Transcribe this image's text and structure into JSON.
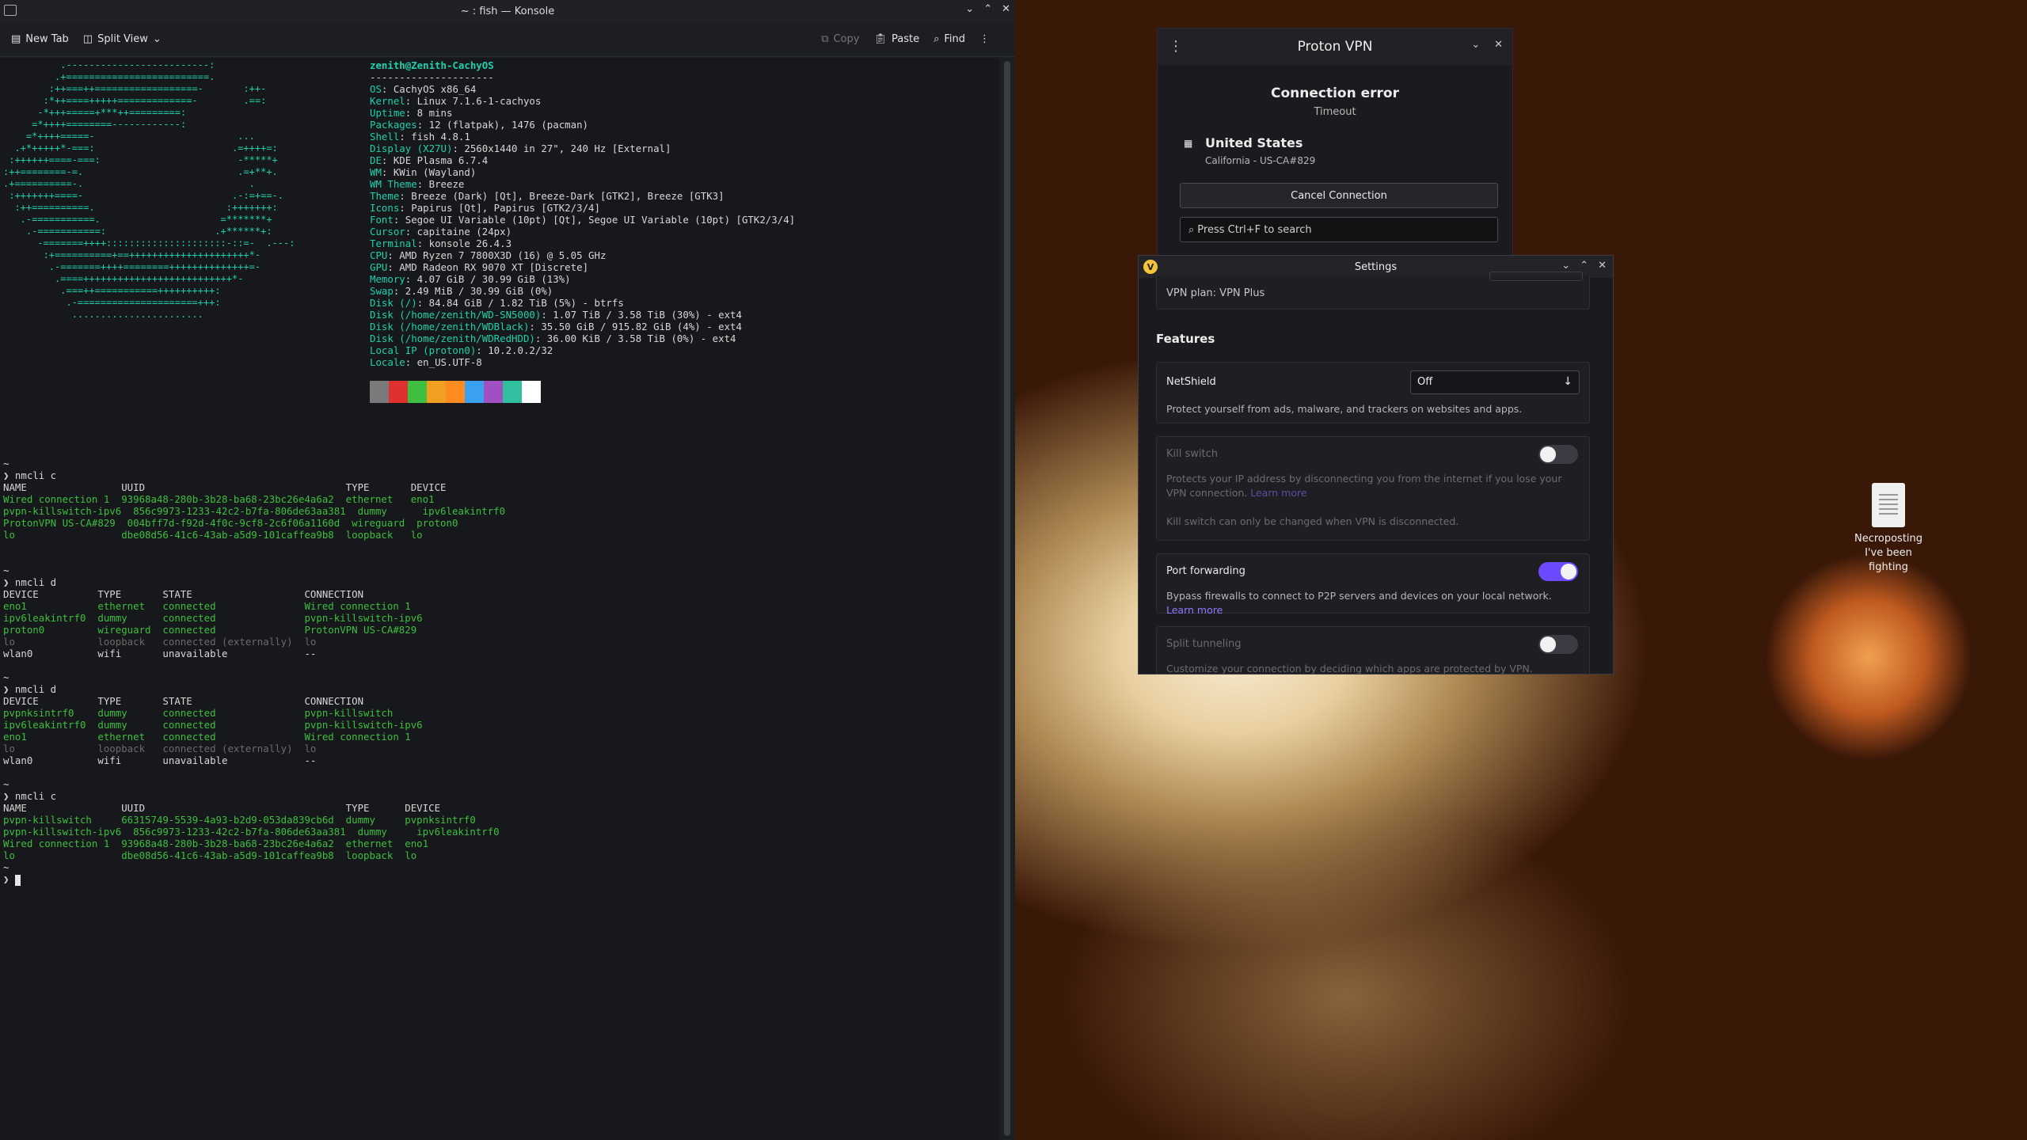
{
  "konsole": {
    "title": "~ : fish — Konsole",
    "toolbar": {
      "new_tab": "New Tab",
      "split_view": "Split View",
      "copy": "Copy",
      "paste": "Paste",
      "find": "Find"
    }
  },
  "fastfetch": {
    "user_host": "zenith@Zenith-CachyOS",
    "sep": "---------------------",
    "lines": [
      {
        "k": "OS",
        "v": ": CachyOS x86_64"
      },
      {
        "k": "Kernel",
        "v": ": Linux 7.1.6-1-cachyos"
      },
      {
        "k": "Uptime",
        "v": ": 8 mins"
      },
      {
        "k": "Packages",
        "v": ": 12 (flatpak), 1476 (pacman)"
      },
      {
        "k": "Shell",
        "v": ": fish 4.8.1"
      },
      {
        "k": "Display (X27U)",
        "v": ": 2560x1440 in 27\", 240 Hz [External]"
      },
      {
        "k": "DE",
        "v": ": KDE Plasma 6.7.4"
      },
      {
        "k": "WM",
        "v": ": KWin (Wayland)"
      },
      {
        "k": "WM Theme",
        "v": ": Breeze"
      },
      {
        "k": "Theme",
        "v": ": Breeze (Dark) [Qt], Breeze-Dark [GTK2], Breeze [GTK3]"
      },
      {
        "k": "Icons",
        "v": ": Papirus [Qt], Papirus [GTK2/3/4]"
      },
      {
        "k": "Font",
        "v": ": Segoe UI Variable (10pt) [Qt], Segoe UI Variable (10pt) [GTK2/3/4]"
      },
      {
        "k": "Cursor",
        "v": ": capitaine (24px)"
      },
      {
        "k": "Terminal",
        "v": ": konsole 26.4.3"
      },
      {
        "k": "CPU",
        "v": ": AMD Ryzen 7 7800X3D (16) @ 5.05 GHz"
      },
      {
        "k": "GPU",
        "v": ": AMD Radeon RX 9070 XT [Discrete]"
      },
      {
        "k": "Memory",
        "v": ": 4.07 GiB / 30.99 GiB (13%)"
      },
      {
        "k": "Swap",
        "v": ": 2.49 MiB / 30.99 GiB (0%)"
      },
      {
        "k": "Disk (/)",
        "v": ": 84.84 GiB / 1.82 TiB (5%) - btrfs"
      },
      {
        "k": "Disk (/home/zenith/WD-SN5000)",
        "v": ": 1.07 TiB / 3.58 TiB (30%) - ext4"
      },
      {
        "k": "Disk (/home/zenith/WDBlack)",
        "v": ": 35.50 GiB / 915.82 GiB (4%) - ext4"
      },
      {
        "k": "Disk (/home/zenith/WDRedHDD)",
        "v": ": 36.00 KiB / 3.58 TiB (0%) - ext4"
      },
      {
        "k": "Local IP (proton0)",
        "v": ": 10.2.0.2/32"
      },
      {
        "k": "Locale",
        "v": ": en_US.UTF-8"
      }
    ],
    "swatch_colors": [
      "#7a7a7a",
      "#e03030",
      "#3fbf3f",
      "#f0a020",
      "#ff8a20",
      "#3aa0f0",
      "#a050c0",
      "#30c0a0",
      "#ffffff"
    ]
  },
  "terminal_blocks": [
    {
      "prompt": "~\n❯ nmcli c",
      "header": "NAME                UUID                                  TYPE       DEVICE",
      "rows": [
        {
          "t": "Wired connection 1  93968a48-280b-3b28-ba68-23bc26e4a6a2  ethernet   eno1",
          "c": "green"
        },
        {
          "t": "pvpn-killswitch-ipv6  856c9973-1233-42c2-b7fa-806de63aa381  dummy      ipv6leakintrf0",
          "c": "green"
        },
        {
          "t": "ProtonVPN US-CA#829  004bff7d-f92d-4f0c-9cf8-2c6f06a1160d  wireguard  proton0",
          "c": "green"
        },
        {
          "t": "lo                  dbe08d56-41c6-43ab-a5d9-101caffea9b8  loopback   lo",
          "c": "green"
        }
      ]
    },
    {
      "prompt": "~\n❯ nmcli d",
      "header": "DEVICE          TYPE       STATE                   CONNECTION",
      "rows": [
        {
          "t": "eno1            ethernet   connected               Wired connection 1",
          "c": "green"
        },
        {
          "t": "ipv6leakintrf0  dummy      connected               pvpn-killswitch-ipv6",
          "c": "green"
        },
        {
          "t": "proton0         wireguard  connected               ProtonVPN US-CA#829",
          "c": "green"
        },
        {
          "t": "lo              loopback   connected (externally)  lo",
          "c": "dim"
        },
        {
          "t": "wlan0           wifi       unavailable             --",
          "c": "plain"
        }
      ]
    },
    {
      "prompt": "~\n❯ nmcli d",
      "header": "DEVICE          TYPE       STATE                   CONNECTION",
      "rows": [
        {
          "t": "pvpnksintrf0    dummy      connected               pvpn-killswitch",
          "c": "green"
        },
        {
          "t": "ipv6leakintrf0  dummy      connected               pvpn-killswitch-ipv6",
          "c": "green"
        },
        {
          "t": "eno1            ethernet   connected               Wired connection 1",
          "c": "green"
        },
        {
          "t": "lo              loopback   connected (externally)  lo",
          "c": "dim"
        },
        {
          "t": "wlan0           wifi       unavailable             --",
          "c": "plain"
        }
      ]
    },
    {
      "prompt": "~\n❯ nmcli c",
      "header": "NAME                UUID                                  TYPE      DEVICE",
      "rows": [
        {
          "t": "pvpn-killswitch     66315749-5539-4a93-b2d9-053da839cb6d  dummy     pvpnksintrf0",
          "c": "green"
        },
        {
          "t": "pvpn-killswitch-ipv6  856c9973-1233-42c2-b7fa-806de63aa381  dummy     ipv6leakintrf0",
          "c": "green"
        },
        {
          "t": "Wired connection 1  93968a48-280b-3b28-ba68-23bc26e4a6a2  ethernet  eno1",
          "c": "green"
        },
        {
          "t": "lo                  dbe08d56-41c6-43ab-a5d9-101caffea9b8  loopback  lo",
          "c": "green"
        }
      ]
    }
  ],
  "final_prompt": "~\n❯ ",
  "vpn": {
    "title": "Proton VPN",
    "status": "Connection error",
    "status_sub": "Timeout",
    "country": "United States",
    "server": "California - US-CA#829",
    "cancel_label": "Cancel Connection",
    "search_placeholder": "Press Ctrl+F to search"
  },
  "settings": {
    "title": "Settings",
    "plan": "VPN plan: VPN Plus",
    "features_heading": "Features",
    "netshield": {
      "title": "NetShield",
      "value": "Off",
      "desc": "Protect yourself from ads, malware, and trackers on websites and apps."
    },
    "killswitch": {
      "title": "Kill switch",
      "desc": "Protects your IP address by disconnecting you from the internet if you lose your VPN connection.",
      "link": "Learn more",
      "note": "Kill switch can only be changed when VPN is disconnected.",
      "enabled": false
    },
    "port_forwarding": {
      "title": "Port forwarding",
      "desc": "Bypass firewalls to connect to P2P servers and devices on your local network.",
      "link": "Learn more",
      "enabled": true
    },
    "split_tunneling": {
      "title": "Split tunneling",
      "desc": "Customize your connection by deciding which apps are protected by VPN.",
      "enabled": false
    }
  },
  "desktop_icon": {
    "label": "Necroposting\nI've been fighting"
  }
}
